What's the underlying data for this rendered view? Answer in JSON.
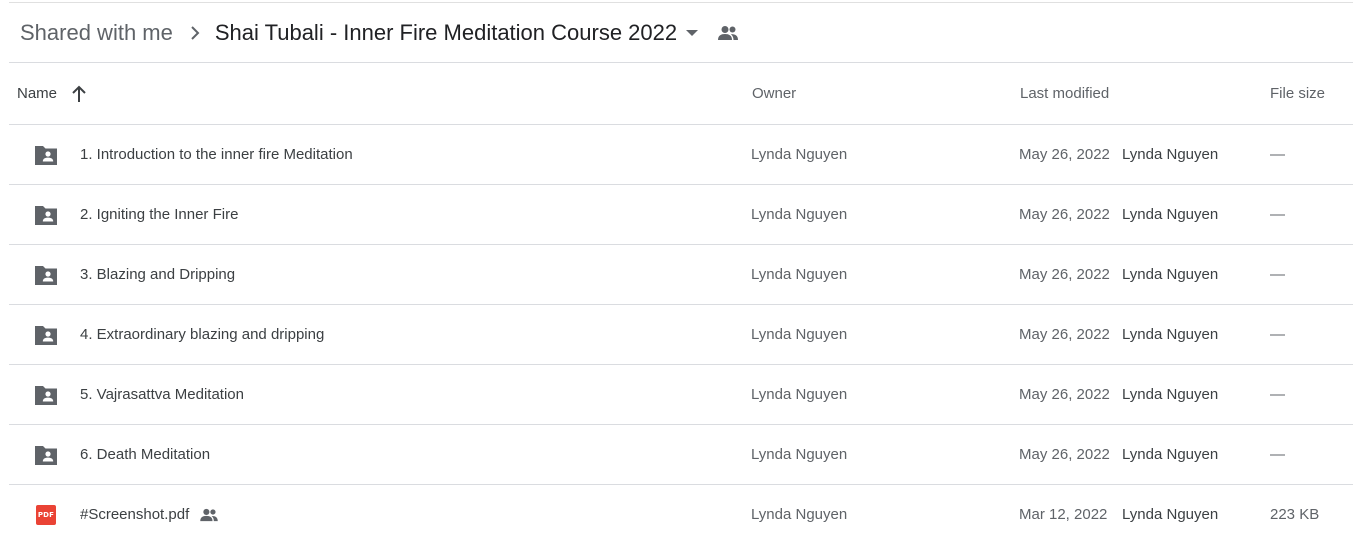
{
  "breadcrumb": {
    "root": "Shared with me",
    "current": "Shai Tubali - Inner Fire Meditation Course 2022"
  },
  "columns": {
    "name": "Name",
    "owner": "Owner",
    "last_modified": "Last modified",
    "file_size": "File size"
  },
  "icons": {
    "separator": "chevron-right-icon",
    "caret": "dropdown-caret-icon",
    "shared": "people-icon",
    "sort": "arrow-up-icon",
    "folder": "shared-folder-icon",
    "pdf": "pdf-icon"
  },
  "colors": {
    "pdf_badge": "#ea4335",
    "folder": "#5f6368",
    "divider": "#dadce0"
  },
  "files": [
    {
      "name": "1. Introduction to the inner fire Meditation",
      "owner": "Lynda Nguyen",
      "date": "May 26, 2022",
      "modified_by": "Lynda Nguyen",
      "size": "—"
    },
    {
      "name": "2. Igniting the Inner Fire",
      "owner": "Lynda Nguyen",
      "date": "May 26, 2022",
      "modified_by": "Lynda Nguyen",
      "size": "—"
    },
    {
      "name": "3. Blazing and Dripping",
      "owner": "Lynda Nguyen",
      "date": "May 26, 2022",
      "modified_by": "Lynda Nguyen",
      "size": "—"
    },
    {
      "name": "4. Extraordinary blazing and dripping",
      "owner": "Lynda Nguyen",
      "date": "May 26, 2022",
      "modified_by": "Lynda Nguyen",
      "size": "—"
    },
    {
      "name": "5. Vajrasattva Meditation",
      "owner": "Lynda Nguyen",
      "date": "May 26, 2022",
      "modified_by": "Lynda Nguyen",
      "size": "—"
    },
    {
      "name": "6. Death Meditation",
      "owner": "Lynda Nguyen",
      "date": "May 26, 2022",
      "modified_by": "Lynda Nguyen",
      "size": "—"
    },
    {
      "name": "#Screenshot.pdf",
      "owner": "Lynda Nguyen",
      "date": "Mar 12, 2022",
      "modified_by": "Lynda Nguyen",
      "size": "223 KB",
      "pdf_label": "PDF"
    }
  ]
}
